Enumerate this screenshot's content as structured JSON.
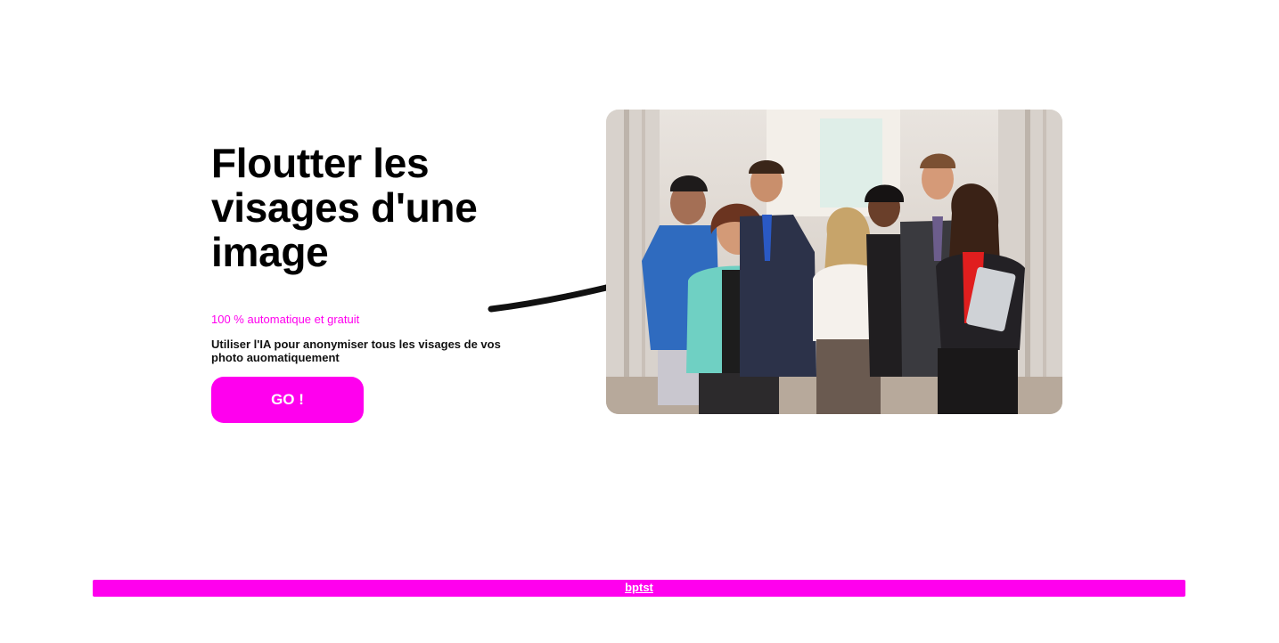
{
  "hero": {
    "title": "Floutter les visages d'une image",
    "tagline": "100 % automatique et gratuit",
    "description": "Utiliser l'IA pour anonymiser tous les visages de vos photo auomatiquement",
    "cta_label": "GO !"
  },
  "footer": {
    "link_label": "bptst"
  },
  "colors": {
    "accent": "#ff00ee",
    "text": "#000000",
    "background": "#ffffff"
  },
  "icons": {
    "arrow": "arrow-right-icon"
  }
}
